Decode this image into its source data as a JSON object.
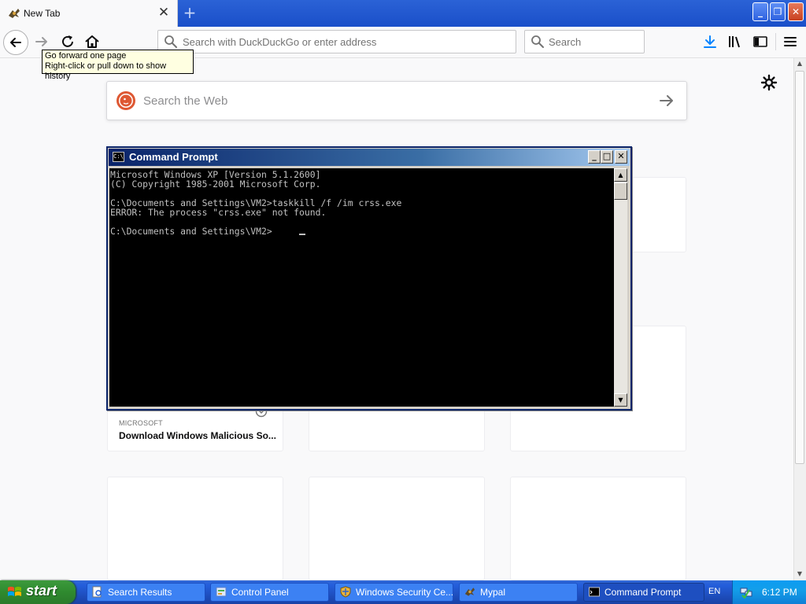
{
  "browser": {
    "tab": {
      "title": "New Tab"
    },
    "toolbar": {
      "urlbar_placeholder": "Search with DuckDuckGo or enter address",
      "searchbar_placeholder": "Search"
    },
    "tooltip": {
      "line1": "Go forward one page",
      "line2": "Right-click or pull down to show history"
    }
  },
  "newtab": {
    "search_placeholder": "Search the Web",
    "highlight_card": {
      "source": "MICROSOFT",
      "title": "Download Windows Malicious So..."
    }
  },
  "cmd": {
    "title": "Command Prompt",
    "icon_text": "C:\\",
    "lines": [
      "Microsoft Windows XP [Version 5.1.2600]",
      "(C) Copyright 1985-2001 Microsoft Corp.",
      "",
      "C:\\Documents and Settings\\VM2>taskkill /f /im crss.exe",
      "ERROR: The process \"crss.exe\" not found.",
      "",
      "C:\\Documents and Settings\\VM2>"
    ]
  },
  "taskbar": {
    "start_label": "start",
    "tasks": [
      {
        "label": "Search Results",
        "icon": "search-results-icon"
      },
      {
        "label": "Control Panel",
        "icon": "control-panel-icon"
      },
      {
        "label": "Windows Security Ce...",
        "icon": "security-center-icon"
      },
      {
        "label": "Mypal",
        "icon": "mypal-icon"
      },
      {
        "label": "Command Prompt",
        "icon": "cmd-icon",
        "active": true
      }
    ],
    "language": "EN",
    "clock": "6:12 PM"
  },
  "colors": {
    "xp_blue": "#245edb",
    "start_green": "#3c9a3c",
    "console_bg": "#000000",
    "console_fg": "#c0c0c0",
    "ddg_orange": "#de5833"
  }
}
